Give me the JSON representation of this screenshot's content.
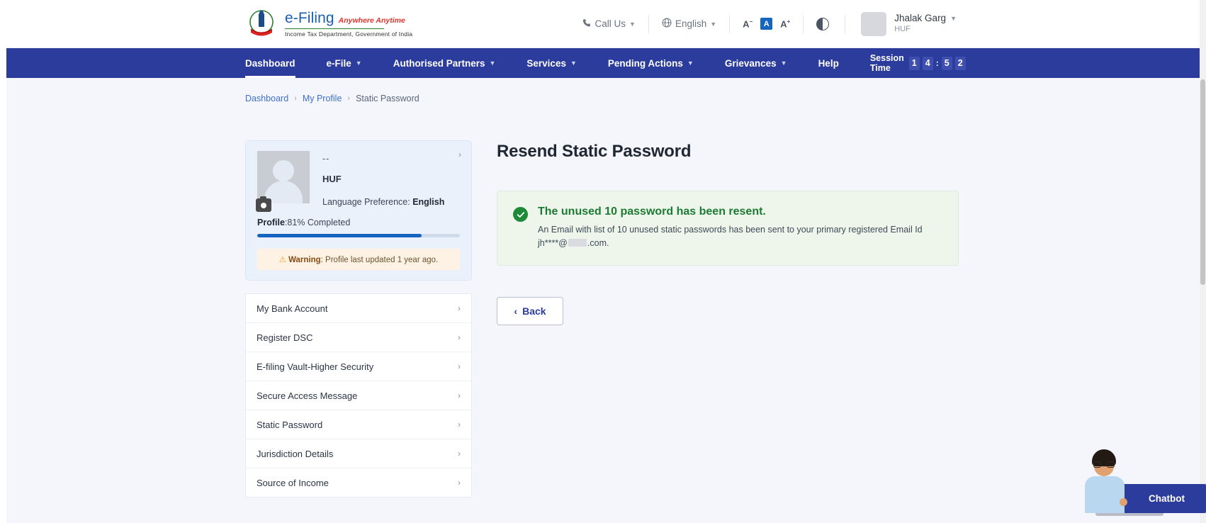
{
  "header": {
    "brand": {
      "title": "e-Filing",
      "tagline": "Anywhere Anytime",
      "department": "Income Tax Department, Government of India",
      "emblem_icon": "india-emblem-icon"
    },
    "call_us": "Call Us",
    "language": "English",
    "font_small": "A",
    "font_normal": "A",
    "font_large": "A",
    "contrast_icon": "contrast-icon",
    "phone_icon": "phone-icon",
    "globe_icon": "globe-icon",
    "user": {
      "name": "Jhalak Garg",
      "type": "HUF"
    }
  },
  "nav": {
    "items": [
      {
        "label": "Dashboard",
        "has_caret": false,
        "active": true
      },
      {
        "label": "e-File",
        "has_caret": true,
        "active": false
      },
      {
        "label": "Authorised Partners",
        "has_caret": true,
        "active": false
      },
      {
        "label": "Services",
        "has_caret": true,
        "active": false
      },
      {
        "label": "Pending Actions",
        "has_caret": true,
        "active": false
      },
      {
        "label": "Grievances",
        "has_caret": true,
        "active": false
      },
      {
        "label": "Help",
        "has_caret": false,
        "active": false
      }
    ],
    "session_label": "Session Time",
    "session_minutes_1": "1",
    "session_minutes_2": "4",
    "session_seconds_1": "5",
    "session_seconds_2": "2",
    "session_colon": ":"
  },
  "breadcrumb": {
    "item1": "Dashboard",
    "item2": "My Profile",
    "current": "Static Password",
    "separator": "›"
  },
  "profile": {
    "name": "--",
    "type": "HUF",
    "language_label": "Language Preference: ",
    "language_value": "English",
    "progress_label": "Profile",
    "progress_text": ":81% Completed",
    "progress_percent": 81,
    "warning_prefix": "Warning",
    "warning_text": ": Profile last updated 1 year ago.",
    "warning_icon": "warning-triangle-icon",
    "camera_icon": "camera-icon",
    "avatar_icon": "user-avatar-icon",
    "chevron": "›"
  },
  "sidebar": {
    "items": [
      {
        "label": "My Bank Account"
      },
      {
        "label": "Register DSC"
      },
      {
        "label": "E-filing Vault-Higher Security"
      },
      {
        "label": "Secure Access Message"
      },
      {
        "label": "Static Password"
      },
      {
        "label": "Jurisdiction Details"
      },
      {
        "label": "Source of Income"
      }
    ],
    "chevron": "›"
  },
  "main": {
    "title": "Resend Static Password",
    "alert": {
      "icon": "success-check-icon",
      "title": "The unused 10 password has been resent.",
      "body_part1": "An Email with list of 10 unused static passwords has been sent to your primary registered Email Id jh****@",
      "body_part2": ".com."
    },
    "back_button": "Back",
    "back_icon": "chevron-left-icon"
  },
  "chatbot": {
    "label": "Chatbot",
    "avatar_icon": "chatbot-avatar-icon"
  },
  "colors": {
    "nav_blue": "#2c3c9c",
    "brand_blue": "#1a5fb4",
    "success_green": "#1d7a33",
    "progress_blue": "#1464c0",
    "link_blue": "#3f6fd0"
  }
}
